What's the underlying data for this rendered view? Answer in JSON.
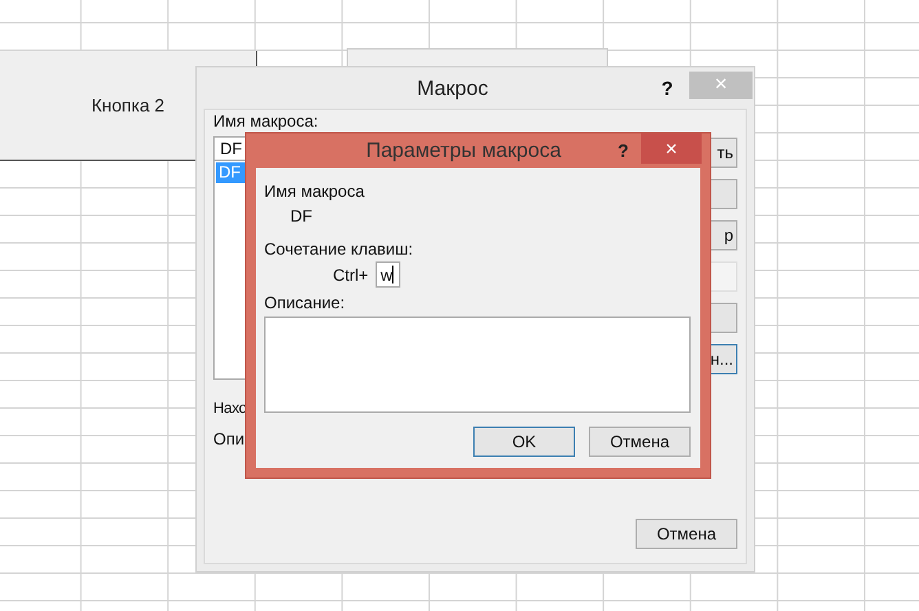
{
  "sheet_button": {
    "label": "Кнопка 2"
  },
  "macro_dialog": {
    "title": "Макрос",
    "help": "?",
    "close": "×",
    "name_label": "Имя макроса:",
    "name_value": "DF",
    "macros": [
      {
        "name": "DF",
        "selected": true
      }
    ],
    "side_buttons": [
      {
        "label": "ть",
        "disabled": false,
        "focused": false
      },
      {
        "disabled": false,
        "focused": false
      },
      {
        "label": "р",
        "disabled": false,
        "focused": false
      },
      {
        "disabled": true,
        "focused": false
      },
      {
        "disabled": false,
        "focused": false
      },
      {
        "label": "н...",
        "disabled": false,
        "focused": true
      }
    ],
    "location_label": "Нахо",
    "description_label": "Опи",
    "cancel": "Отмена"
  },
  "options_dialog": {
    "title": "Параметры макроса",
    "help": "?",
    "close": "×",
    "name_label": "Имя макроса",
    "name_value": "DF",
    "shortcut_label": "Сочетание клавиш:",
    "ctrl_label": "Ctrl+",
    "shortcut_key": "w",
    "description_label": "Описание:",
    "buttons": [
      {
        "label": "OK",
        "focused": true
      },
      {
        "label": "Отмена",
        "focused": false
      }
    ]
  }
}
